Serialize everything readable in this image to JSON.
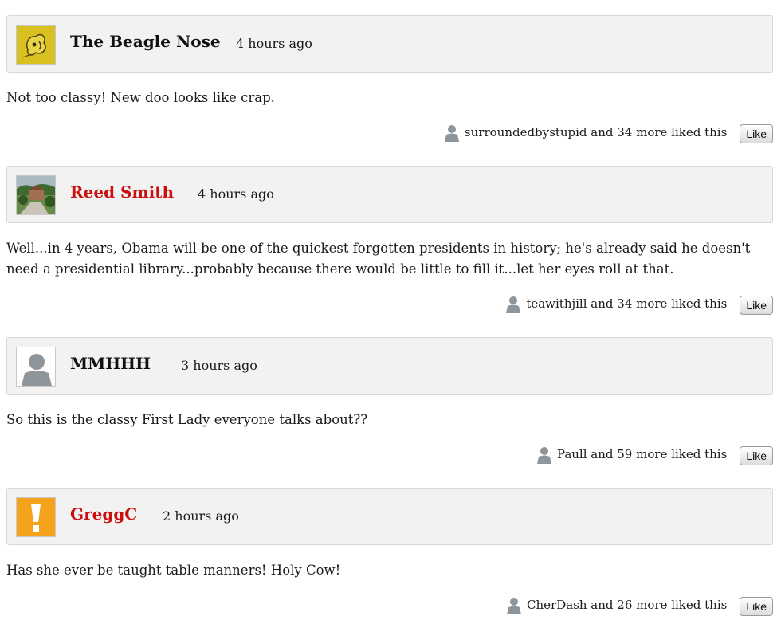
{
  "comments": [
    {
      "username": "The Beagle Nose",
      "timestamp": "4 hours ago",
      "text": "Not too classy! New doo looks like crap.",
      "likes": "surroundedbystupid and 34 more liked this",
      "like_label": "Like"
    },
    {
      "username": "Reed Smith",
      "timestamp": "4 hours ago",
      "text": "Well...in 4 years, Obama will be one of the quickest forgotten presidents in history; he's already said he doesn't need a presidential library...probably because there would be little to fill it...let her eyes roll at that.",
      "likes": "teawithjill and 34 more liked this",
      "like_label": "Like"
    },
    {
      "username": "MMHHH",
      "timestamp": "3 hours ago",
      "text": "So this is the classy First Lady everyone talks about??",
      "likes": "Paull and 59 more liked this",
      "like_label": "Like"
    },
    {
      "username": "GreggC",
      "timestamp": "2 hours ago",
      "text": "Has she ever be taught table manners!  Holy Cow!",
      "likes": "CherDash and 26 more liked this",
      "like_label": "Like"
    }
  ],
  "colors": {
    "header_bg": "#f2f2f2",
    "username_default": "#111111",
    "username_link": "#cc1010"
  },
  "icons": [
    "beagle-avatar-icon",
    "landscape-avatar-icon",
    "default-user-icon",
    "exclamation-avatar-icon",
    "user-silhouette-icon"
  ]
}
